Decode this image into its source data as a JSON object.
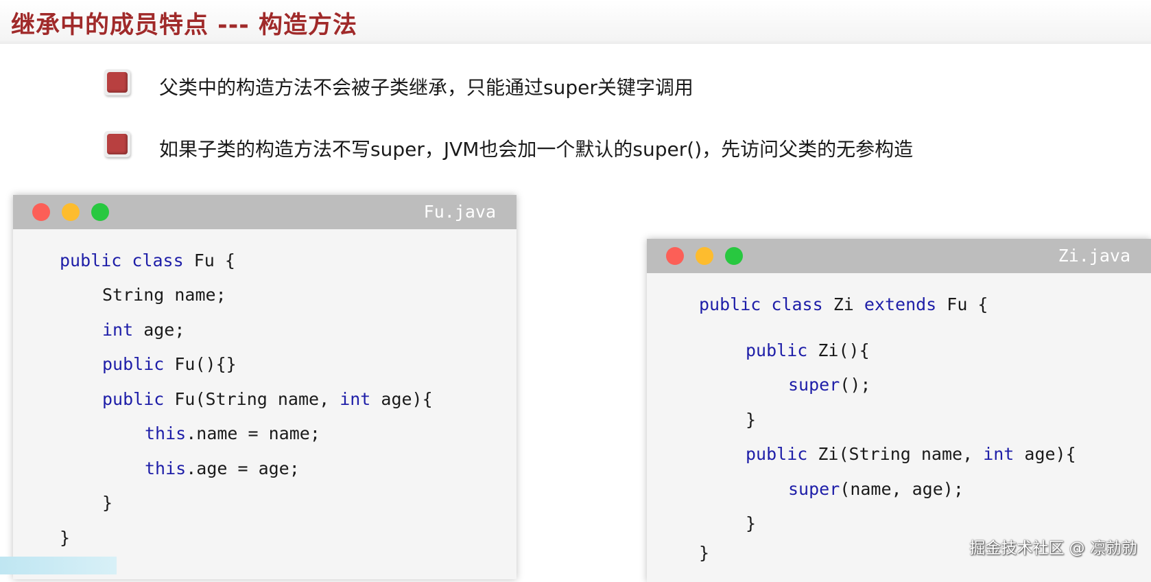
{
  "slide": {
    "title": "继承中的成员特点 --- 构造方法",
    "bullets": [
      "父类中的构造方法不会被子类继承，只能通过super关键字调用",
      "如果子类的构造方法不写super，JVM也会加一个默认的super()，先访问父类的无参构造"
    ]
  },
  "fu_window": {
    "filename": "Fu.java",
    "lines": [
      [
        {
          "t": "public",
          "k": true
        },
        {
          "t": " "
        },
        {
          "t": "class",
          "k": true
        },
        {
          "t": " Fu {"
        }
      ],
      [
        {
          "t": "String name;"
        }
      ],
      [
        {
          "t": "int",
          "k": true
        },
        {
          "t": " age;"
        }
      ],
      [
        {
          "t": "public",
          "k": true
        },
        {
          "t": " Fu(){}"
        }
      ],
      [
        {
          "t": "public",
          "k": true
        },
        {
          "t": " Fu(String name, "
        },
        {
          "t": "int",
          "k": true
        },
        {
          "t": " age){"
        }
      ],
      [
        {
          "t": "this",
          "k": true
        },
        {
          "t": ".name = name;"
        }
      ],
      [
        {
          "t": "this",
          "k": true
        },
        {
          "t": ".age = age;"
        }
      ],
      [
        {
          "t": "}"
        }
      ],
      [
        {
          "t": "}"
        }
      ]
    ]
  },
  "zi_window": {
    "filename": "Zi.java",
    "lines": [
      [
        {
          "t": "public",
          "k": true
        },
        {
          "t": " "
        },
        {
          "t": "class",
          "k": true
        },
        {
          "t": " Zi "
        },
        {
          "t": "extends",
          "k": true
        },
        {
          "t": " Fu {"
        }
      ],
      [
        {
          "t": "public",
          "k": true
        },
        {
          "t": " Zi(){"
        }
      ],
      [
        {
          "t": "super",
          "k": true
        },
        {
          "t": "();"
        }
      ],
      [
        {
          "t": "}"
        }
      ],
      [
        {
          "t": "public",
          "k": true
        },
        {
          "t": " Zi(String name, "
        },
        {
          "t": "int",
          "k": true
        },
        {
          "t": " age){"
        }
      ],
      [
        {
          "t": "super",
          "k": true
        },
        {
          "t": "(name, age);"
        }
      ],
      [
        {
          "t": "}"
        }
      ],
      [
        {
          "t": "}"
        }
      ]
    ]
  },
  "watermark": "掘金技术社区 @ 凛勍勍",
  "colors": {
    "title": "#a02a2a",
    "keyword": "#1e1ea8",
    "bullet": "#b84040"
  }
}
